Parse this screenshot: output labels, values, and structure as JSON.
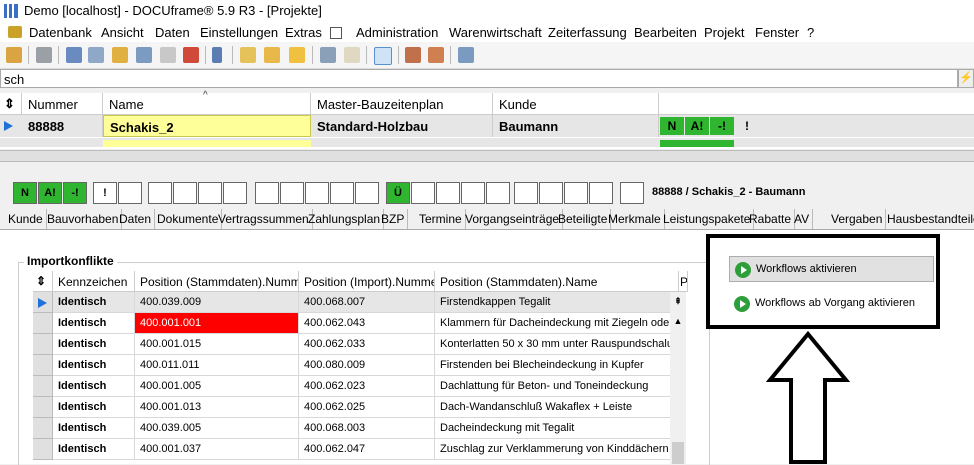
{
  "window": {
    "title": "Demo [localhost] - DOCUframe® 5.9 R3 - [Projekte]"
  },
  "menu": [
    "Datenbank",
    "Ansicht",
    "Daten",
    "Einstellungen",
    "Extras",
    "Administration",
    "Warenwirtschaft",
    "Zeiterfassung",
    "Bearbeiten",
    "Projekt",
    "Fenster",
    "?"
  ],
  "search": {
    "value": "sch"
  },
  "projects_table": {
    "headers": [
      "Nummer",
      "Name",
      "Master-Bauzeitenplan",
      "Kunde"
    ],
    "row": {
      "nummer": "88888",
      "name": "Schakis_2",
      "master": "Standard-Holzbau",
      "kunde": "Baumann"
    },
    "flags": [
      "N",
      "A!",
      "-!",
      "!"
    ]
  },
  "status_strip": {
    "flags": [
      "N",
      "A!",
      "-!",
      "!",
      "Ü"
    ],
    "label": "88888 / Schakis_2 - Baumann"
  },
  "tabs": [
    "Kunde",
    "Bauvorhaben",
    "Daten",
    "Dokumente",
    "Vertragssummen",
    "Zahlungsplan",
    "BZP",
    "Termine",
    "Vorgangseinträge",
    "Beteiligte",
    "Merkmale",
    "Leistungspakete",
    "Rabatte",
    "AV",
    "Vergaben",
    "Hausbestandteile"
  ],
  "import_conflicts": {
    "title": "Importkonflikte",
    "headers": [
      "Kennzeichen",
      "Position (Stammdaten).Nummer",
      "Position (Import).Nummer",
      "Position (Stammdaten).Name",
      "P"
    ],
    "rows": [
      {
        "kennzeichen": "Identisch",
        "stamm_nr": "400.039.009",
        "import_nr": "400.068.007",
        "name": "Firstendkappen Tegalit"
      },
      {
        "kennzeichen": "Identisch",
        "stamm_nr": "400.001.001",
        "import_nr": "400.062.043",
        "name": "Klammern für Dacheindeckung mit Ziegeln oder"
      },
      {
        "kennzeichen": "Identisch",
        "stamm_nr": "400.001.015",
        "import_nr": "400.062.033",
        "name": "Konterlatten 50 x 30 mm unter Rauspundschalu"
      },
      {
        "kennzeichen": "Identisch",
        "stamm_nr": "400.011.011",
        "import_nr": "400.080.009",
        "name": "Firstenden bei Blecheindeckung in Kupfer"
      },
      {
        "kennzeichen": "Identisch",
        "stamm_nr": "400.001.005",
        "import_nr": "400.062.023",
        "name": "Dachlattung für Beton- und Toneindeckung"
      },
      {
        "kennzeichen": "Identisch",
        "stamm_nr": "400.001.013",
        "import_nr": "400.062.025",
        "name": "Dach-Wandanschluß Wakaflex + Leiste"
      },
      {
        "kennzeichen": "Identisch",
        "stamm_nr": "400.039.005",
        "import_nr": "400.068.003",
        "name": "Dacheindeckung mit Tegalit"
      },
      {
        "kennzeichen": "Identisch",
        "stamm_nr": "400.001.037",
        "import_nr": "400.062.047",
        "name": "Zuschlag zur Verklammerung von Kinddächern"
      }
    ]
  },
  "workflows": {
    "activate_label": "Workflows aktivieren",
    "activate_from_label": "Workflows ab Vorgang aktivieren"
  },
  "colors": {
    "flag_green": "#2fb52f",
    "highlight_red": "#ff0000",
    "name_yellow": "#ffff99"
  }
}
